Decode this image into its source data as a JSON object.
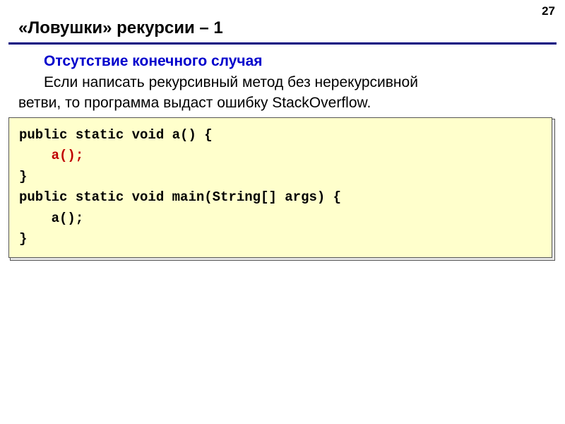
{
  "page_number": "27",
  "title": "«Ловушки» рекурсии – 1",
  "subtitle": "Отсутствие конечного случая",
  "paragraph_indented": "Если написать рекурсивный метод без нерекурсивной",
  "paragraph_rest": "ветви, то программа выдаст ошибку StackOverflow.",
  "code": {
    "l1": "public static void a() {",
    "l2_indent": "    ",
    "l2_call": "a();",
    "l3": "}",
    "l4": "public static void main(String[] args) {",
    "l5": "    a();",
    "l6": "}"
  }
}
